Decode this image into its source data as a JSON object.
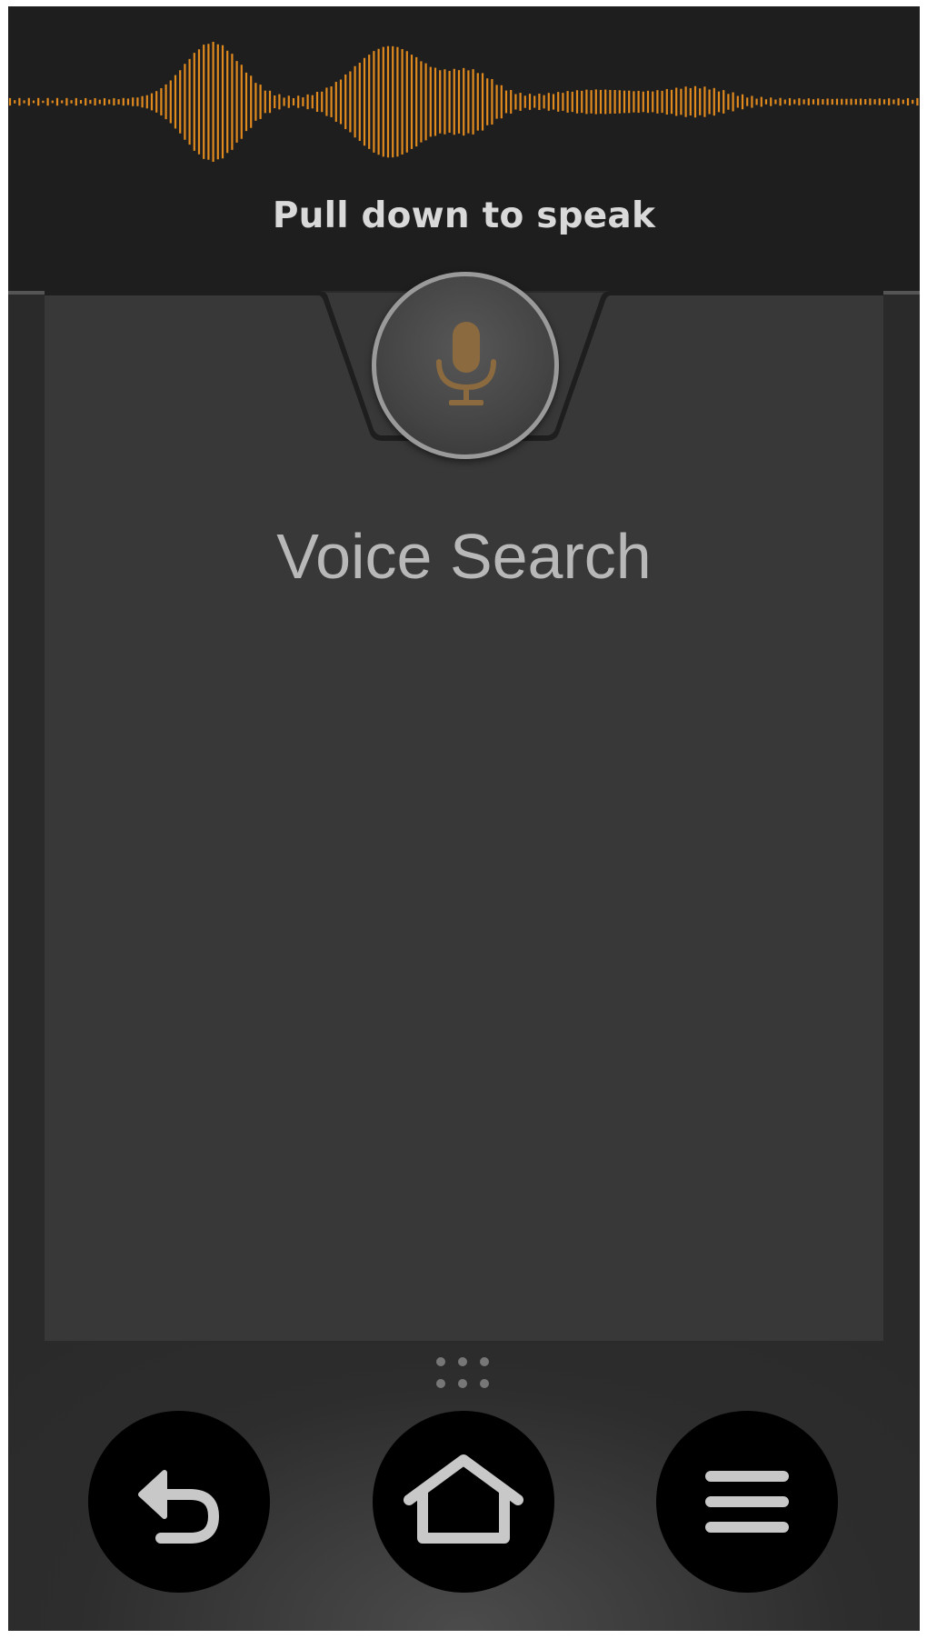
{
  "top_panel": {
    "hint": "Pull down to speak"
  },
  "main": {
    "title": "Voice Search"
  },
  "icons": {
    "mic": "microphone-icon",
    "drag_handle": "drag-handle-dots",
    "back": "back-arrow-icon",
    "home": "home-icon",
    "menu": "hamburger-menu-icon"
  },
  "colors": {
    "accent_orange": "#e08a1e",
    "mic_glyph": "#8a6a3e",
    "background": "#2a2a2a",
    "top_panel": "#1e1e1e",
    "content_panel": "#383838",
    "nav_button": "#000000",
    "nav_icon": "#c8c8c8"
  }
}
